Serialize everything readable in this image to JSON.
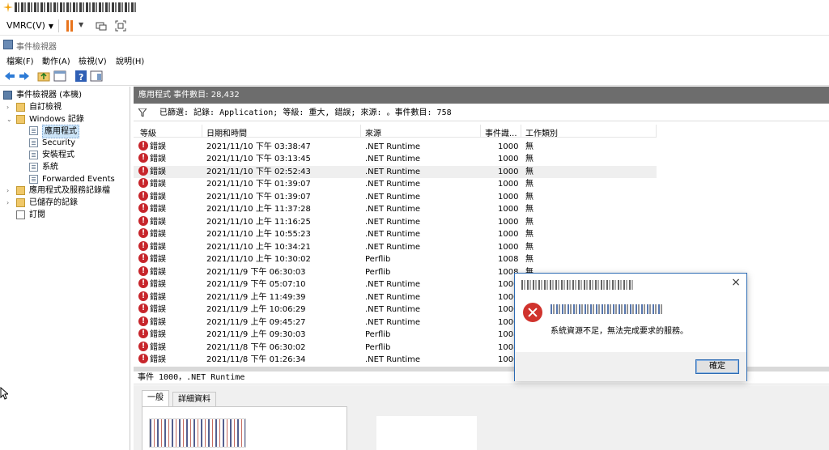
{
  "vmrc": {
    "menu_label": "VMRC(V)",
    "window_title": "\\\\\\\\VMRC - Event Viewer"
  },
  "event_viewer": {
    "title": "事件檢視器",
    "menu": [
      "檔案(F)",
      "動作(A)",
      "檢視(V)",
      "說明(H)"
    ]
  },
  "tree": [
    {
      "label": "事件檢視器 (本機)",
      "icon": "computer-icon",
      "twisty": ""
    },
    {
      "label": "自訂檢視",
      "icon": "folder-icon",
      "twisty": "›"
    },
    {
      "label": "Windows 記錄",
      "icon": "folder-icon",
      "twisty": "⌄"
    },
    {
      "label": "應用程式",
      "icon": "log-icon",
      "twisty": "",
      "selected": true
    },
    {
      "label": "Security",
      "icon": "log-icon",
      "twisty": ""
    },
    {
      "label": "安裝程式",
      "icon": "log-icon",
      "twisty": ""
    },
    {
      "label": "系統",
      "icon": "log-icon",
      "twisty": ""
    },
    {
      "label": "Forwarded Events",
      "icon": "log-icon",
      "twisty": ""
    },
    {
      "label": "應用程式及服務記錄檔",
      "icon": "folder-icon",
      "twisty": "›"
    },
    {
      "label": "已儲存的記錄",
      "icon": "folder-icon",
      "twisty": "›"
    },
    {
      "label": "訂閱",
      "icon": "subscription-icon",
      "twisty": ""
    }
  ],
  "pane_header": "應用程式   事件數目: 28,432",
  "filter_text": "已篩選: 記錄: Application; 等級: 重大, 錯誤; 來源: 。事件數目: 758",
  "columns": [
    "等級",
    "日期和時間",
    "來源",
    "事件識...",
    "工作類別"
  ],
  "events": [
    {
      "level": "錯誤",
      "datetime": "2021/11/10 下午 03:38:47",
      "source": ".NET Runtime",
      "id": "1000",
      "category": "無"
    },
    {
      "level": "錯誤",
      "datetime": "2021/11/10 下午 03:13:45",
      "source": ".NET Runtime",
      "id": "1000",
      "category": "無"
    },
    {
      "level": "錯誤",
      "datetime": "2021/11/10 下午 02:52:43",
      "source": ".NET Runtime",
      "id": "1000",
      "category": "無"
    },
    {
      "level": "錯誤",
      "datetime": "2021/11/10 下午 01:39:07",
      "source": ".NET Runtime",
      "id": "1000",
      "category": "無"
    },
    {
      "level": "錯誤",
      "datetime": "2021/11/10 下午 01:39:07",
      "source": ".NET Runtime",
      "id": "1000",
      "category": "無"
    },
    {
      "level": "錯誤",
      "datetime": "2021/11/10 上午 11:37:28",
      "source": ".NET Runtime",
      "id": "1000",
      "category": "無"
    },
    {
      "level": "錯誤",
      "datetime": "2021/11/10 上午 11:16:25",
      "source": ".NET Runtime",
      "id": "1000",
      "category": "無"
    },
    {
      "level": "錯誤",
      "datetime": "2021/11/10 上午 10:55:23",
      "source": ".NET Runtime",
      "id": "1000",
      "category": "無"
    },
    {
      "level": "錯誤",
      "datetime": "2021/11/10 上午 10:34:21",
      "source": ".NET Runtime",
      "id": "1000",
      "category": "無"
    },
    {
      "level": "錯誤",
      "datetime": "2021/11/10 上午 10:30:02",
      "source": "Perflib",
      "id": "1008",
      "category": "無"
    },
    {
      "level": "錯誤",
      "datetime": "2021/11/9 下午 06:30:03",
      "source": "Perflib",
      "id": "1008",
      "category": "無"
    },
    {
      "level": "錯誤",
      "datetime": "2021/11/9 下午 05:07:10",
      "source": ".NET Runtime",
      "id": "1000",
      "category": ""
    },
    {
      "level": "錯誤",
      "datetime": "2021/11/9 上午 11:49:39",
      "source": ".NET Runtime",
      "id": "1000",
      "category": ""
    },
    {
      "level": "錯誤",
      "datetime": "2021/11/9 上午 10:06:29",
      "source": ".NET Runtime",
      "id": "1000",
      "category": ""
    },
    {
      "level": "錯誤",
      "datetime": "2021/11/9 上午 09:45:27",
      "source": ".NET Runtime",
      "id": "1000",
      "category": ""
    },
    {
      "level": "錯誤",
      "datetime": "2021/11/9 上午 09:30:03",
      "source": "Perflib",
      "id": "1008",
      "category": ""
    },
    {
      "level": "錯誤",
      "datetime": "2021/11/8 下午 06:30:02",
      "source": "Perflib",
      "id": "1008",
      "category": ""
    },
    {
      "level": "錯誤",
      "datetime": "2021/11/8 下午 01:26:34",
      "source": ".NET Runtime",
      "id": "1000",
      "category": ""
    }
  ],
  "detail_header": "事件 1000，.NET Runtime",
  "detail_tabs": [
    "一般",
    "詳細資料"
  ],
  "dialog": {
    "message": "系統資源不足，無法完成要求的服務。",
    "ok_label": "確定",
    "close_glyph": "×"
  },
  "colors": {
    "accent": "#2b6ab3",
    "error": "#c7252b",
    "pause": "#e8741c",
    "pane_header": "#6d6d6d"
  }
}
